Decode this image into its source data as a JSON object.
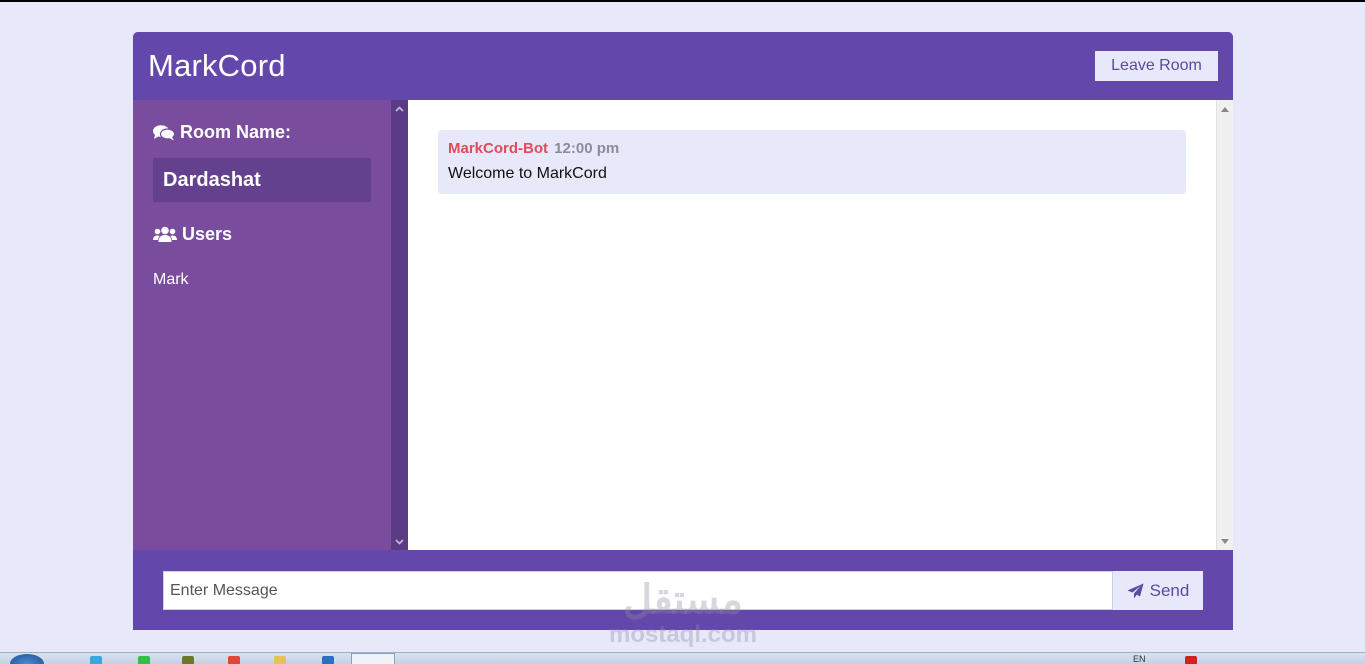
{
  "app": {
    "title": "MarkCord",
    "leave_label": "Leave Room"
  },
  "sidebar": {
    "room_heading": "Room Name:",
    "room_name": "Dardashat",
    "users_heading": "Users",
    "users": [
      "Mark"
    ]
  },
  "chat": {
    "messages": [
      {
        "author": "MarkCord-Bot",
        "time": "12:00 pm",
        "text": "Welcome to MarkCord"
      }
    ]
  },
  "composer": {
    "placeholder": "Enter Message",
    "send_label": "Send"
  },
  "watermark": {
    "arabic": "مستقل",
    "latin": "mostaql.com"
  },
  "taskbar": {
    "language": "EN"
  },
  "colors": {
    "page_bg": "#e8e8fb",
    "brand": "#6447aa",
    "sidebar": "#794c9e",
    "room_box": "#64418e",
    "author": "#e24b5a"
  },
  "icons": {
    "room": "comments-icon",
    "users": "users-icon",
    "send": "paper-plane-icon"
  }
}
